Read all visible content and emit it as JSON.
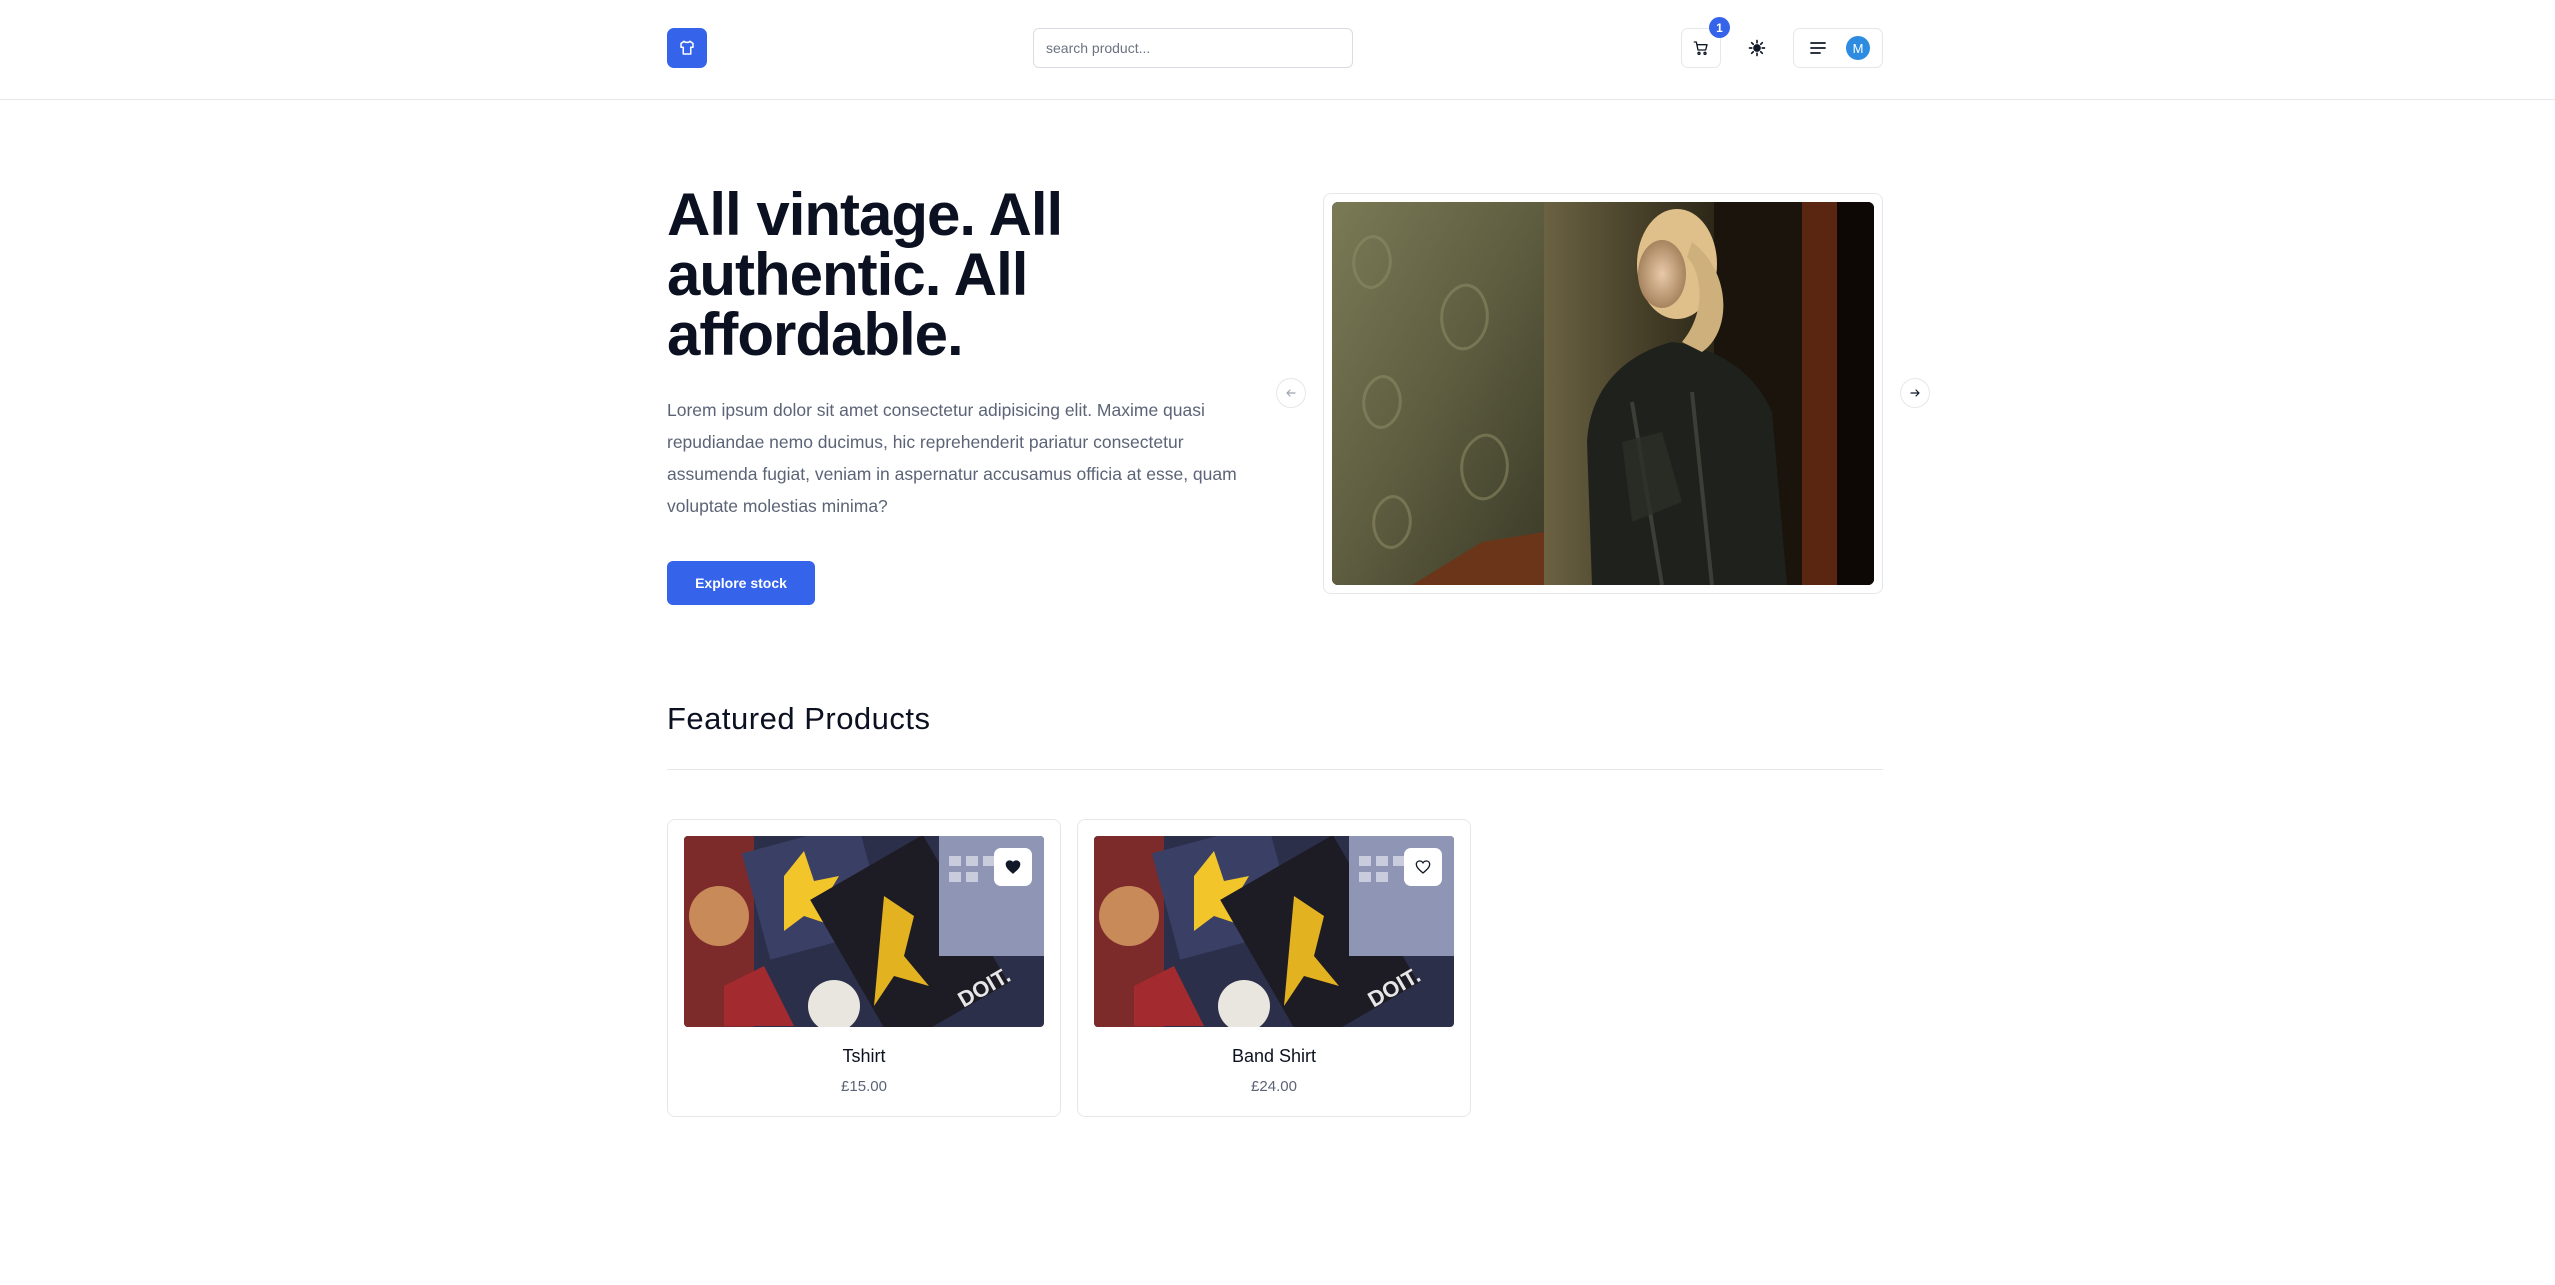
{
  "header": {
    "logo_icon": "shirt-icon",
    "search": {
      "placeholder": "search product..."
    },
    "cart_count": "1",
    "cart_icon": "cart-icon",
    "theme_icon": "sun-icon",
    "menu_icon": "hamburger-icon",
    "avatar_initial": "M"
  },
  "hero": {
    "title": "All vintage. All authentic. All affordable.",
    "description": "Lorem ipsum dolor sit amet consectetur adipisicing elit. Maxime quasi repudiandae nemo ducimus, hic reprehenderit pariatur consectetur assumenda fugiat, veniam in aspernatur accusamus officia at esse, quam voluptate molestias minima?",
    "cta_label": "Explore stock",
    "carousel": {
      "prev_icon": "arrow-left-icon",
      "next_icon": "arrow-right-icon"
    }
  },
  "featured": {
    "title": "Featured Products",
    "products": [
      {
        "name": "Tshirt",
        "price": "£15.00",
        "favorited": true
      },
      {
        "name": "Band Shirt",
        "price": "£24.00",
        "favorited": false
      }
    ]
  },
  "colors": {
    "primary": "#3563e9",
    "text": "#0b1120",
    "muted": "#5b6477",
    "border": "#e5e7eb",
    "avatar": "#2d8ce0"
  }
}
